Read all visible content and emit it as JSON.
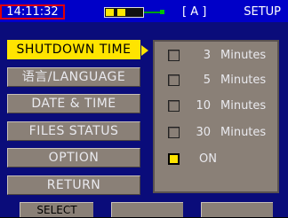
{
  "status": {
    "time": "14:11:32",
    "mode": "[ A ]",
    "screen_title": "SETUP",
    "battery_level": 0.6
  },
  "menu": {
    "items": [
      {
        "label": "SHUTDOWN TIME",
        "active": true
      },
      {
        "label": "语言/LANGUAGE",
        "active": false
      },
      {
        "label": "DATE & TIME",
        "active": false
      },
      {
        "label": "FILES STATUS",
        "active": false
      },
      {
        "label": "OPTION",
        "active": false
      },
      {
        "label": "RETURN",
        "active": false
      }
    ]
  },
  "shutdown_options": [
    {
      "value": "3",
      "unit": "Minutes",
      "checked": false
    },
    {
      "value": "5",
      "unit": "Minutes",
      "checked": false
    },
    {
      "value": "10",
      "unit": "Minutes",
      "checked": false
    },
    {
      "value": "30",
      "unit": "Minutes",
      "checked": false
    },
    {
      "value": "ON",
      "unit": "",
      "checked": true
    }
  ],
  "softkeys": [
    "SELECT",
    "",
    ""
  ],
  "colors": {
    "background": "#0a0c7a",
    "topbar": "#0000c8",
    "accent": "#ffe400",
    "button": "#8a8077",
    "clock_border": "#e00000"
  }
}
